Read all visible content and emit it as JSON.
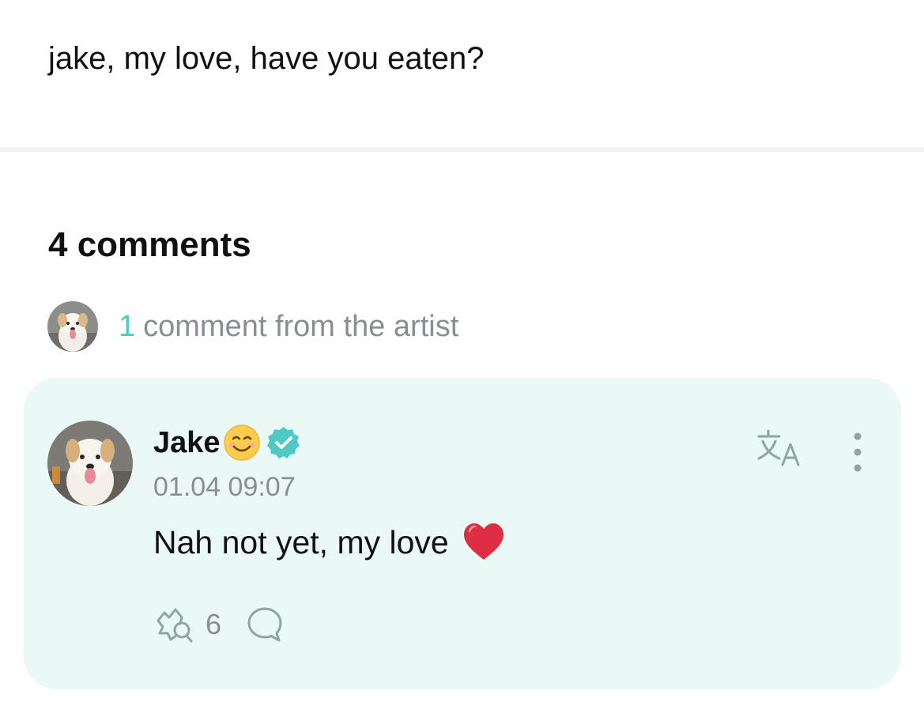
{
  "post": {
    "text": "jake, my love, have you eaten?"
  },
  "comments_section": {
    "title": "4 comments",
    "artist_comments": {
      "count": "1",
      "label": "comment from the artist",
      "avatar_icon": "dog-avatar"
    }
  },
  "comment": {
    "author": "Jake",
    "author_emoji": "smiling-face-emoji",
    "verified_icon": "verified-badge-icon",
    "timestamp": "01.04 09:07",
    "text": "Nah not yet, my love",
    "text_emoji": "red-heart-emoji",
    "likes": "6",
    "translate_icon": "translate-icon",
    "more_icon": "more-vertical-icon",
    "reply_icon": "reply-bubble-icon"
  },
  "colors": {
    "accent": "#4fc9c6",
    "card_background": "#eaf8f6",
    "muted_text": "#8a8e92",
    "icon_gray": "#90a4a1"
  }
}
